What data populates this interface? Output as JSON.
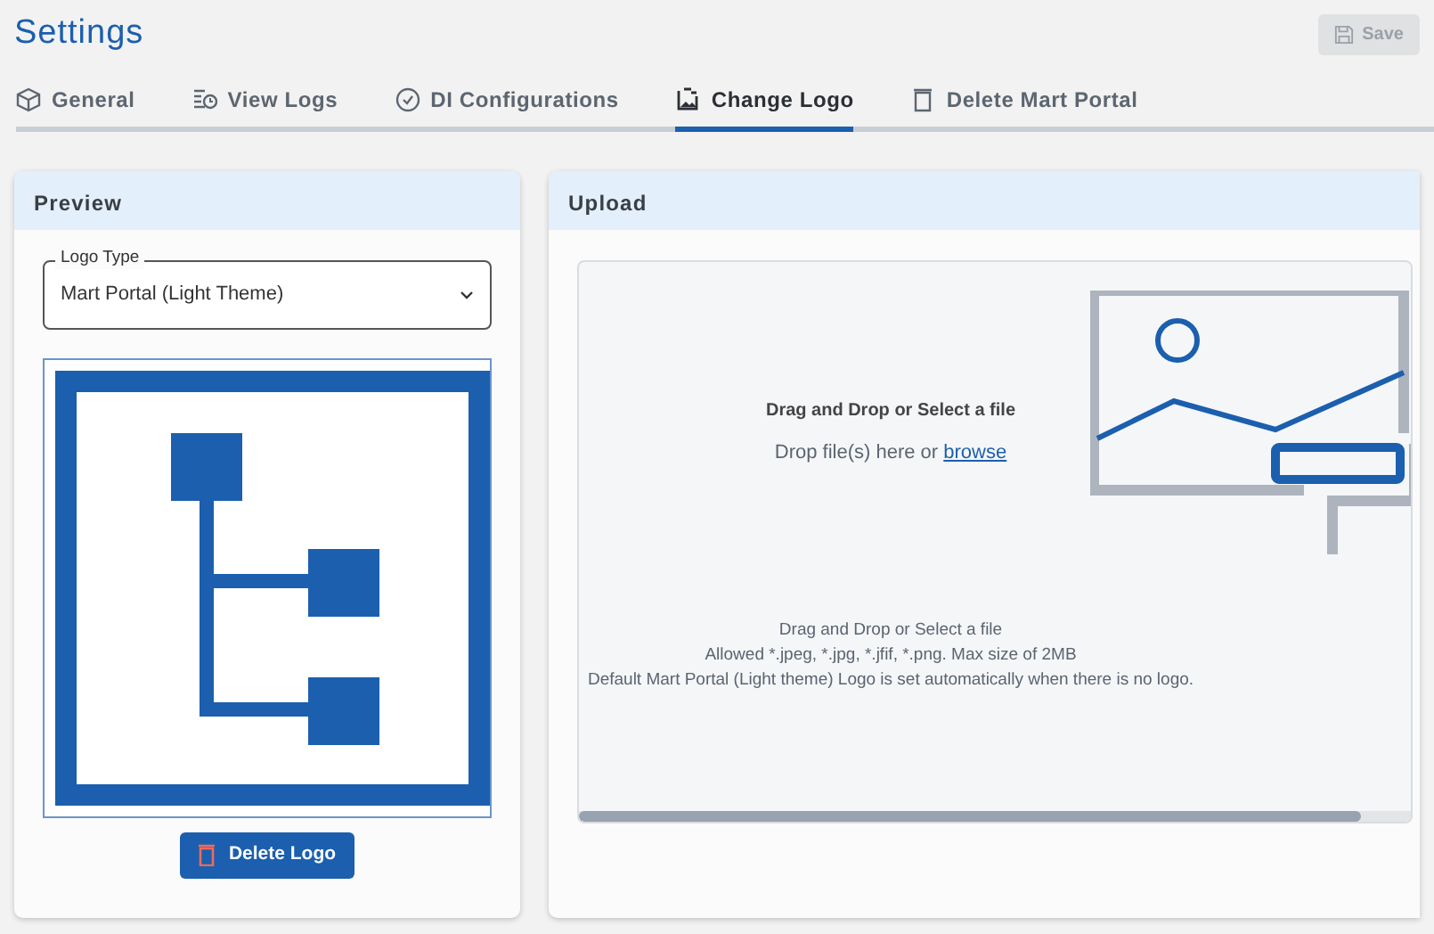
{
  "title": "Settings",
  "save_button": {
    "label": "Save",
    "disabled": true
  },
  "tabs": [
    {
      "label": "General",
      "kind": "cube",
      "selected": false
    },
    {
      "label": "View Logs",
      "kind": "logs",
      "selected": false
    },
    {
      "label": "DI Configurations",
      "kind": "check",
      "selected": false
    },
    {
      "label": "Change Logo",
      "kind": "image",
      "selected": true
    },
    {
      "label": "Delete Mart Portal",
      "kind": "trash",
      "selected": false
    }
  ],
  "preview": {
    "title": "Preview",
    "logo_type": {
      "label": "Logo Type",
      "value": "Mart Portal (Light Theme)"
    },
    "delete_button": "Delete Logo"
  },
  "upload": {
    "title": "Upload",
    "heading": "Drag and Drop or Select a file",
    "drop_text": "Drop file(s) here or",
    "browse_link": "browse",
    "notes": [
      "Drag and Drop or Select a file",
      "Allowed *.jpeg, *.jpg, *.jfif, *.png. Max size of 2MB",
      "Default Mart Portal (Light theme) Logo is set automatically when there is no logo."
    ]
  }
}
